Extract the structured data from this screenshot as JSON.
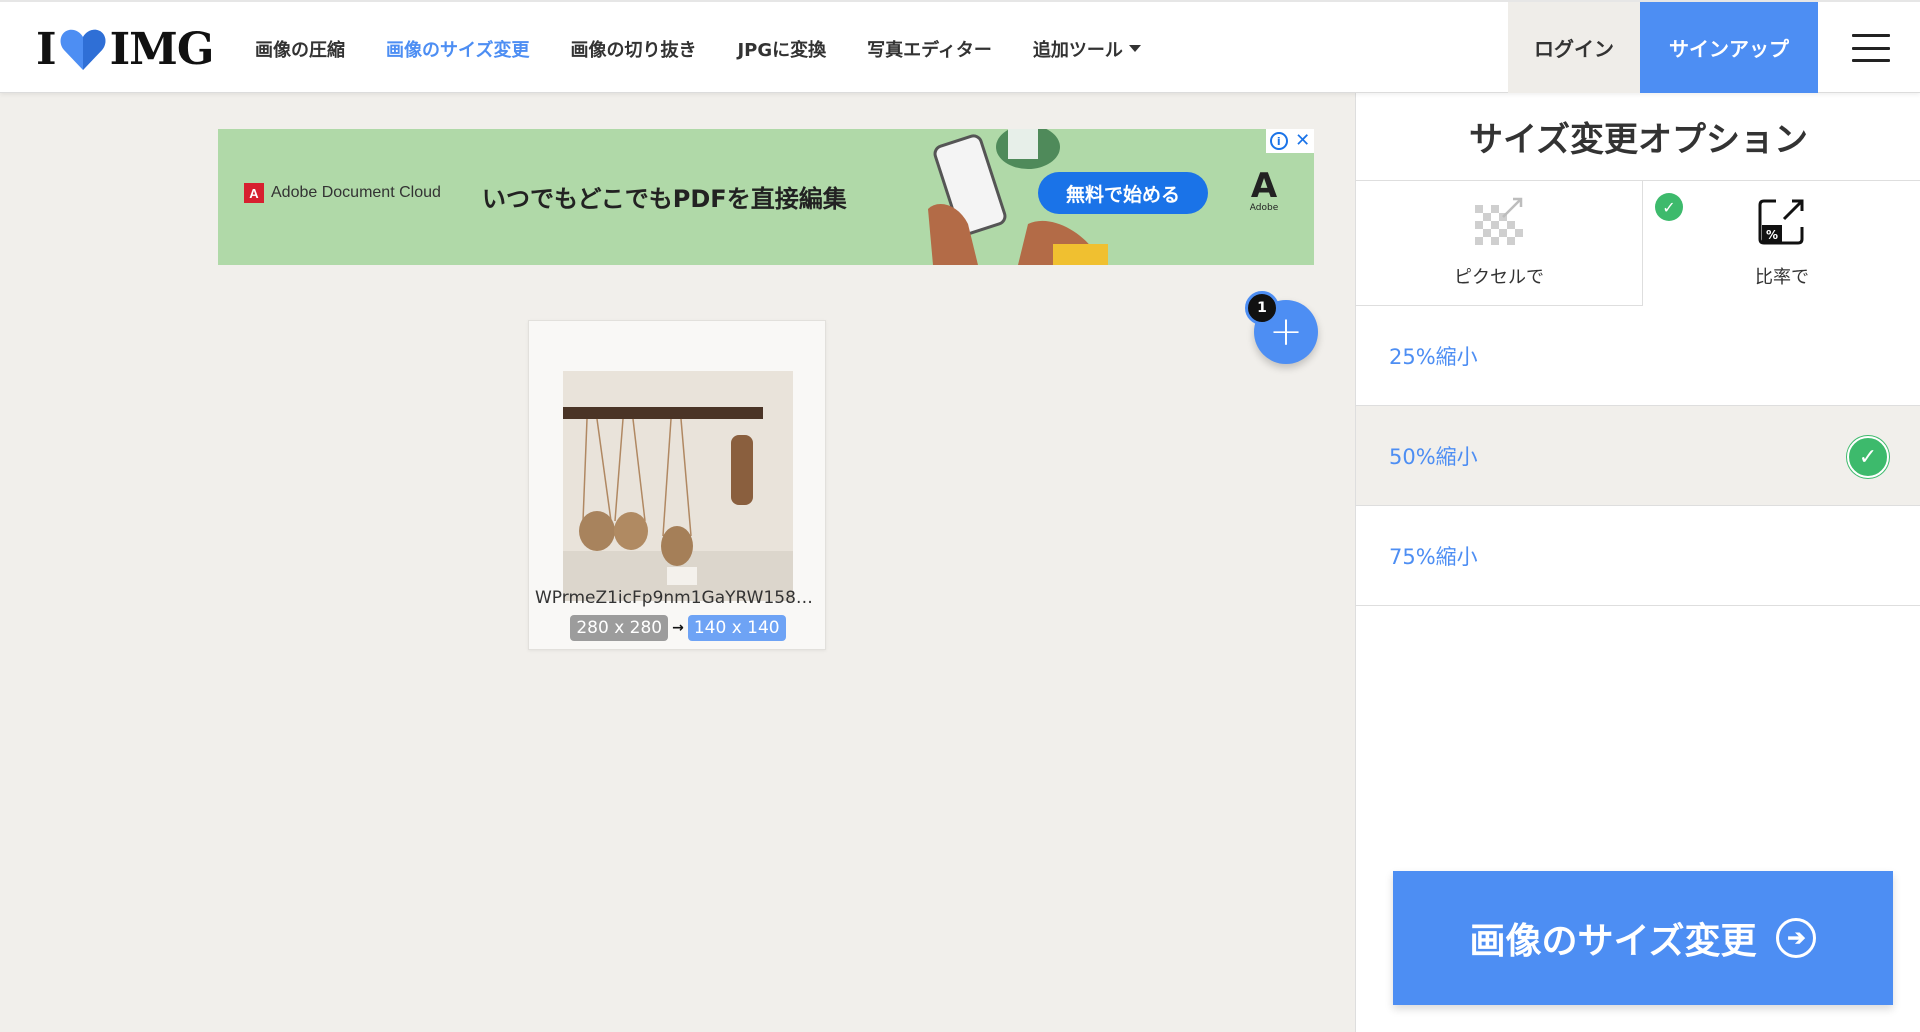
{
  "header": {
    "logo_left": "I",
    "logo_right": "IMG",
    "nav": [
      {
        "label": "画像の圧縮"
      },
      {
        "label": "画像のサイズ変更"
      },
      {
        "label": "画像の切り抜き"
      },
      {
        "label": "JPGに変換"
      },
      {
        "label": "写真エディター"
      },
      {
        "label": "追加ツール"
      }
    ],
    "login": "ログイン",
    "signup": "サインアップ"
  },
  "ad": {
    "brand": "Adobe Document Cloud",
    "brand_mark": "A",
    "text": "いつでもどこでもPDFを直接編集",
    "cta": "無料で始める",
    "adobe_word": "Adobe",
    "choices_i": "i",
    "choices_x": "✕"
  },
  "workspace": {
    "file_count": "1",
    "add_symbol": "+",
    "file": {
      "name": "WPrmeZ1icFp9nm1GaYRW1586...",
      "original_size": "280 x 280",
      "new_size": "140 x 140",
      "arrow": "→"
    }
  },
  "sidebar": {
    "title": "サイズ変更オプション",
    "tabs": [
      {
        "label": "ピクセルで"
      },
      {
        "label": "比率で"
      }
    ],
    "options": [
      {
        "label": "25%縮小"
      },
      {
        "label": "50%縮小"
      },
      {
        "label": "75%縮小"
      }
    ],
    "check": "✓",
    "action": "画像のサイズ変更",
    "action_arrow": "➔"
  },
  "colors": {
    "accent": "#4d8ef3",
    "success": "#3dba6c",
    "background": "#f1efeb"
  }
}
